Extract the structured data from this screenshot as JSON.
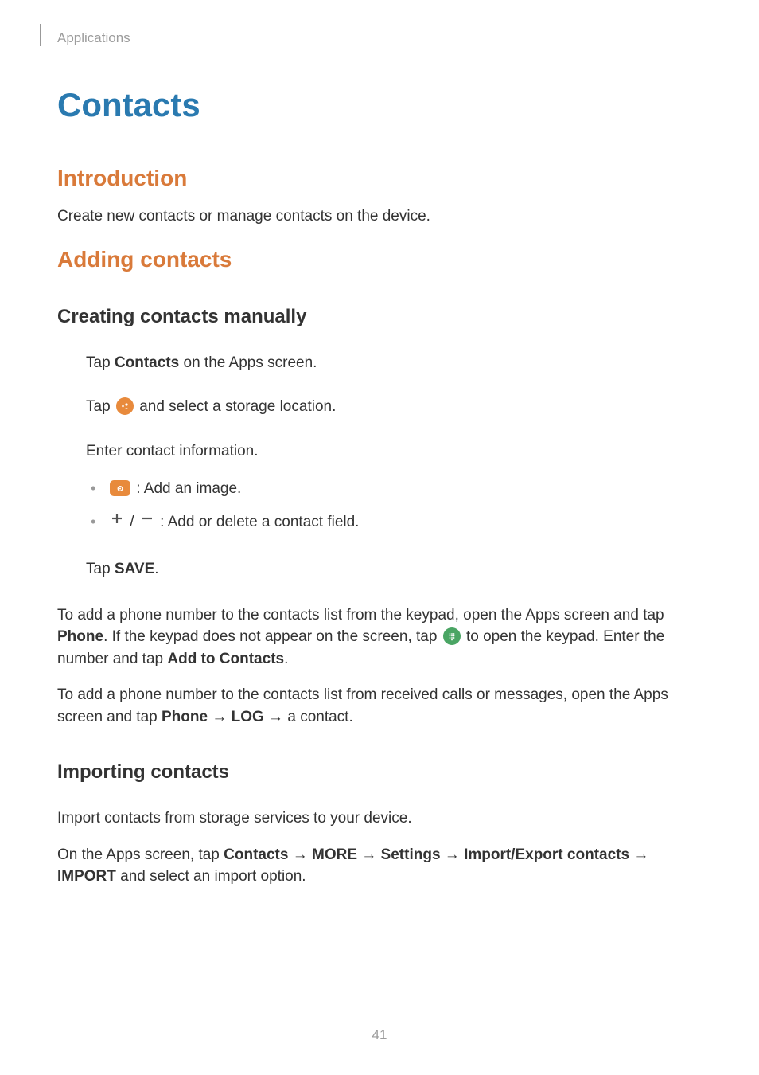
{
  "breadcrumb": "Applications",
  "page_title": "Contacts",
  "section_intro": {
    "title": "Introduction",
    "body1": "Create new contacts or manage contacts on the device."
  },
  "section_adding": {
    "title": "Adding contacts",
    "sub_creating": {
      "title": "Creating contacts manually",
      "step1_pre": "Tap ",
      "step1_bold": "Contacts",
      "step1_post": " on the Apps screen.",
      "step2_pre": "Tap ",
      "step2_post": " and select a storage location.",
      "step3": "Enter contact information.",
      "bullet1_post": " : Add an image.",
      "bullet2_mid": " / ",
      "bullet2_post": " : Add or delete a contact field.",
      "step4_pre": "Tap ",
      "step4_bold": "SAVE",
      "step4_post": ".",
      "after_p1_a": "To add a phone number to the contacts list from the keypad, open the Apps screen and tap ",
      "after_p1_bold1": "Phone",
      "after_p1_b": ". If the keypad does not appear on the screen, tap ",
      "after_p1_c": " to open the keypad. Enter the number and tap ",
      "after_p1_bold2": "Add to Contacts",
      "after_p1_d": ".",
      "after_p2_a": "To add a phone number to the contacts list from received calls or messages, open the Apps screen and tap ",
      "after_p2_bold1": "Phone",
      "after_p2_arrow1": " → ",
      "after_p2_bold2": "LOG",
      "after_p2_arrow2": " → ",
      "after_p2_b": "a contact."
    },
    "sub_importing": {
      "title": "Importing contacts",
      "body1": "Import contacts from storage services to your device.",
      "body2_a": "On the Apps screen, tap ",
      "body2_b1": "Contacts",
      "body2_ar1": " → ",
      "body2_b2": "MORE",
      "body2_ar2": " → ",
      "body2_b3": "Settings",
      "body2_ar3": " → ",
      "body2_b4": "Import/Export contacts",
      "body2_ar4": " → ",
      "body2_b5": "IMPORT",
      "body2_c": " and select an import option."
    }
  },
  "page_number": "41"
}
